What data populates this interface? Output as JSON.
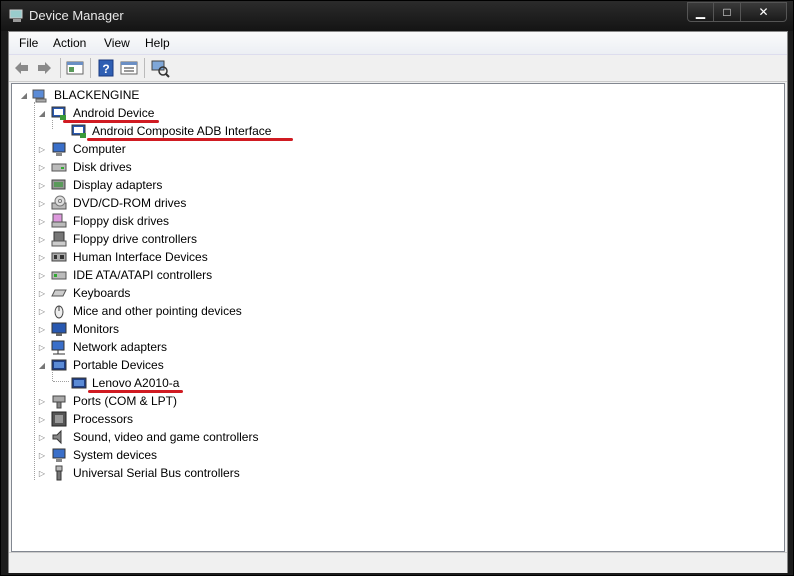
{
  "window": {
    "title": "Device Manager"
  },
  "menu": [
    "File",
    "Action",
    "View",
    "Help"
  ],
  "toolbar": {
    "buttons": [
      "back-icon",
      "forward-icon",
      "show-hide-tree-icon",
      "help-icon",
      "properties-icon",
      "scan-hardware-icon"
    ]
  },
  "tree": {
    "root": "BLACKENGINE",
    "categories": [
      {
        "label": "Android Device",
        "expanded": true,
        "children": [
          "Android Composite ADB Interface"
        ],
        "icon": "android-device-icon"
      },
      {
        "label": "Computer",
        "icon": "computer-icon"
      },
      {
        "label": "Disk drives",
        "icon": "disk-drive-icon"
      },
      {
        "label": "Display adapters",
        "icon": "display-adapter-icon"
      },
      {
        "label": "DVD/CD-ROM drives",
        "icon": "dvd-drive-icon"
      },
      {
        "label": "Floppy disk drives",
        "icon": "floppy-disk-icon"
      },
      {
        "label": "Floppy drive controllers",
        "icon": "floppy-controller-icon"
      },
      {
        "label": "Human Interface Devices",
        "icon": "hid-icon"
      },
      {
        "label": "IDE ATA/ATAPI controllers",
        "icon": "ide-controller-icon"
      },
      {
        "label": "Keyboards",
        "icon": "keyboard-icon"
      },
      {
        "label": "Mice and other pointing devices",
        "icon": "mouse-icon"
      },
      {
        "label": "Monitors",
        "icon": "monitor-icon"
      },
      {
        "label": "Network adapters",
        "icon": "network-adapter-icon"
      },
      {
        "label": "Portable Devices",
        "expanded": true,
        "children": [
          "Lenovo A2010-a"
        ],
        "icon": "portable-device-icon"
      },
      {
        "label": "Ports (COM & LPT)",
        "icon": "port-icon"
      },
      {
        "label": "Processors",
        "icon": "processor-icon"
      },
      {
        "label": "Sound, video and game controllers",
        "icon": "sound-icon"
      },
      {
        "label": "System devices",
        "icon": "system-device-icon"
      },
      {
        "label": "Universal Serial Bus controllers",
        "icon": "usb-icon"
      }
    ]
  },
  "colors": {
    "highlight_underline": "#d01b22",
    "titlebar": "#1c1c1c"
  }
}
